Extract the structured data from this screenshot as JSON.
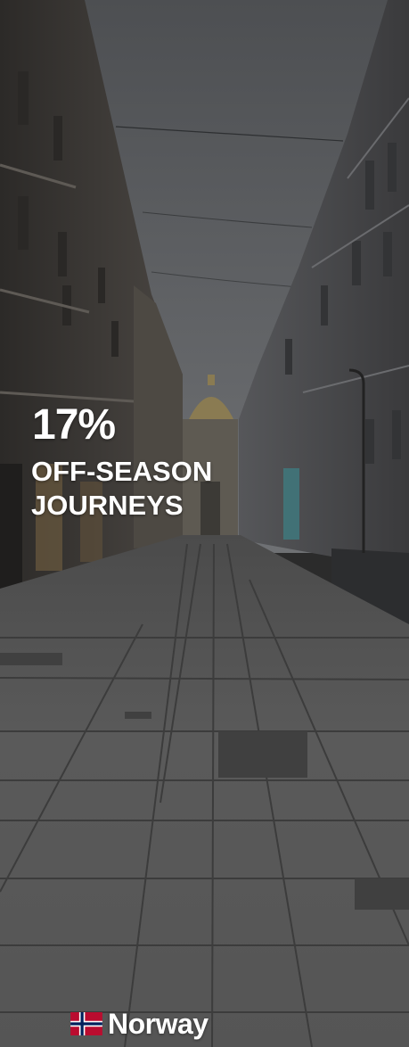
{
  "promo": {
    "stat": "17%",
    "caption_line1": "OFF-SEASON",
    "caption_line2": "JOURNEYS"
  },
  "location": {
    "country": "Norway",
    "flag_icon": "norway-flag-icon"
  },
  "background": {
    "description_icon": "street-photo",
    "tint": "#3a3a3a"
  }
}
